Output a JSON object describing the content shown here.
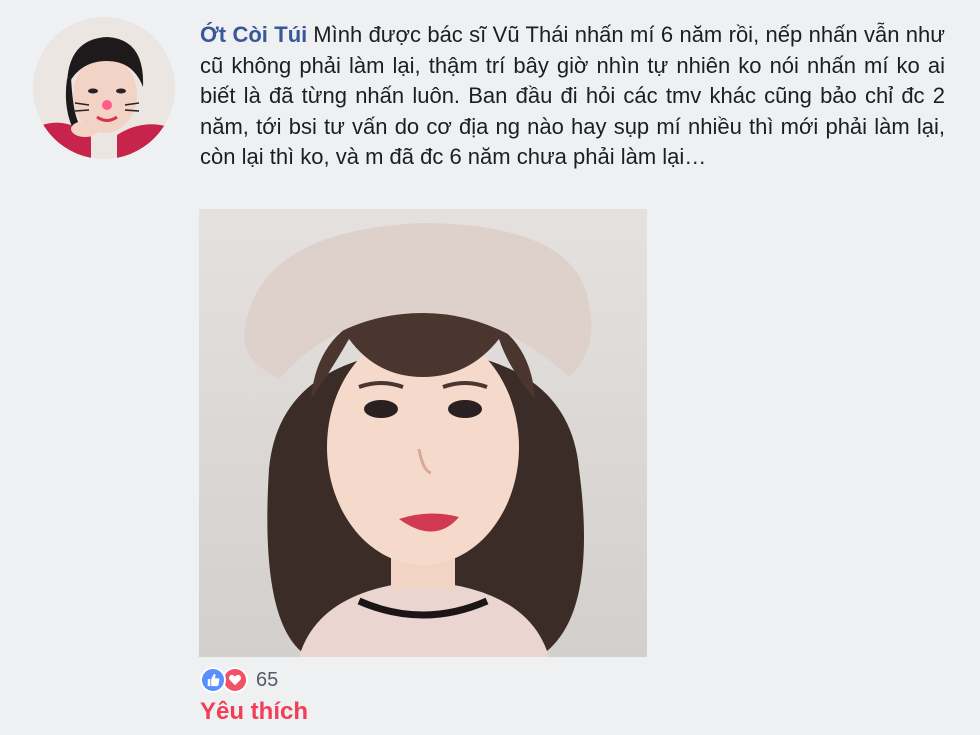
{
  "comment": {
    "author": "Ớt Còi Túi",
    "text": "Mình được bác sĩ Vũ Thái nhấn mí 6 năm rồi, nếp nhấn vẫn như cũ không phải làm lại, thậm trí bây giờ nhìn tự nhiên ko nói nhấn mí ko ai biết là đã từng nhấn luôn. Ban đầu đi hỏi các tmv khác cũng bảo chỉ đc 2 năm, tới bsi tư vấn do cơ địa ng nào hay sụp mí nhiều thì mới phải làm lại, còn lại thì ko, và m đã đc 6 năm chưa phải làm lại…"
  },
  "reactions": {
    "icons": [
      "like-icon",
      "love-icon"
    ],
    "count": "65",
    "like_color": "#5890ff",
    "love_color": "#f25268"
  },
  "action": {
    "label": "Yêu thích",
    "color": "#f33e58"
  },
  "colors": {
    "author": "#385898",
    "background": "#eff0f2"
  }
}
